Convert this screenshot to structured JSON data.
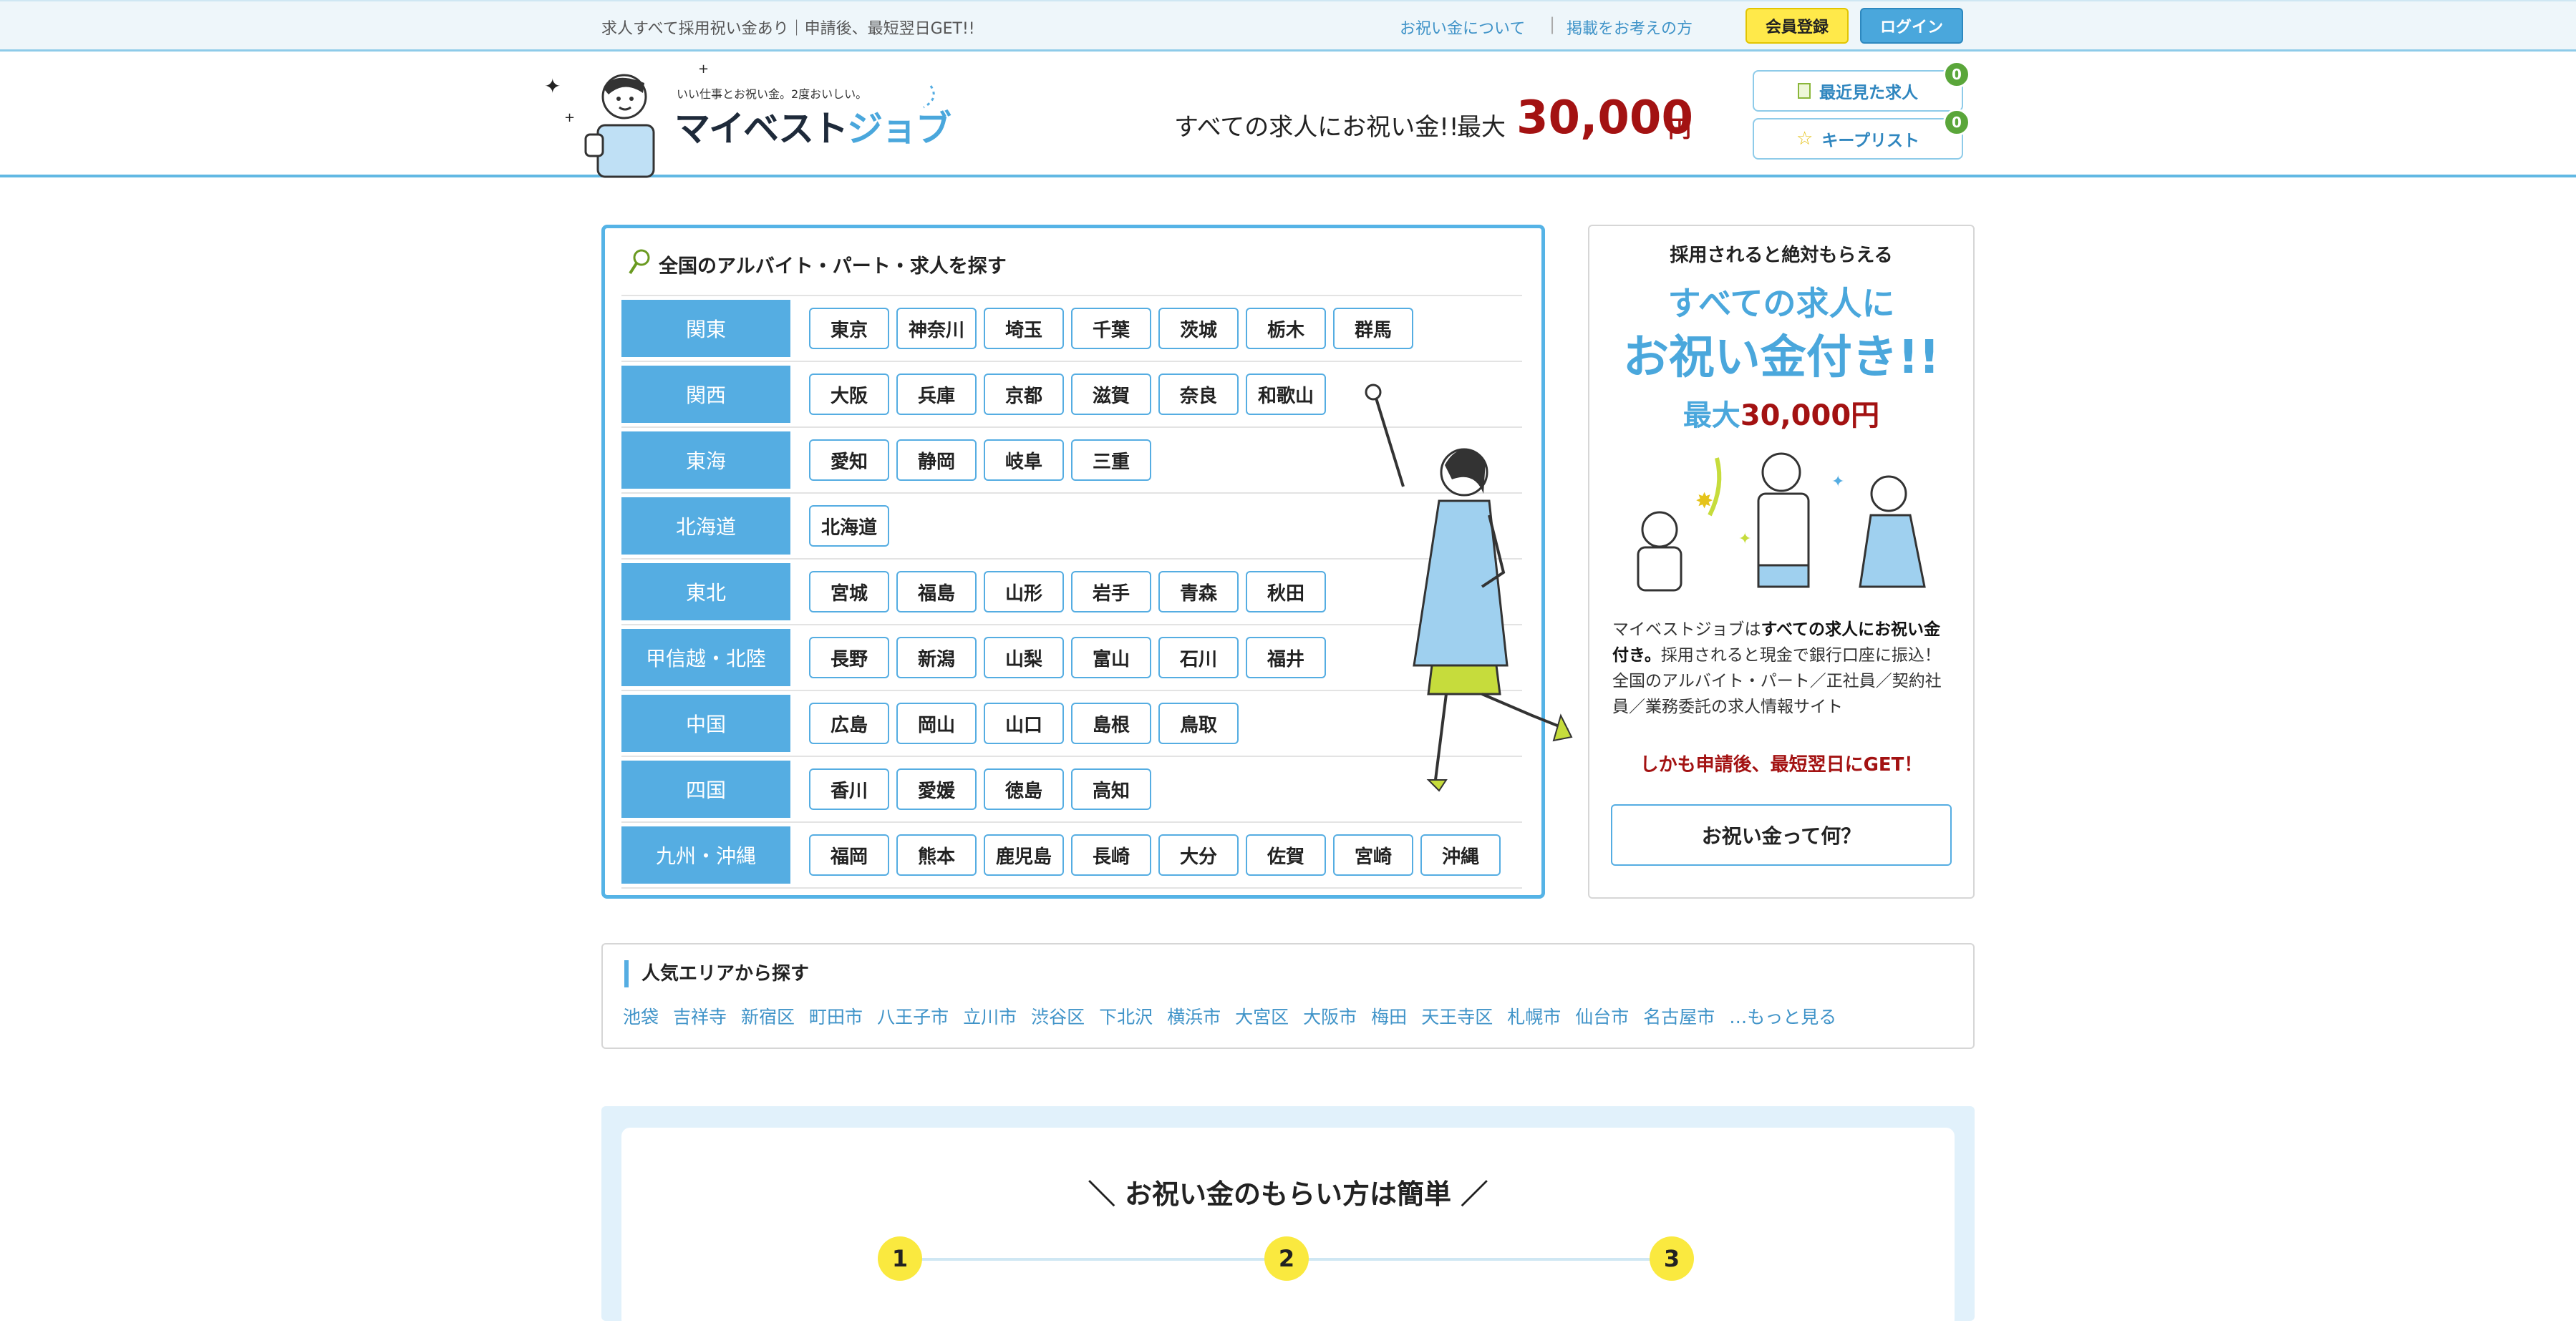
{
  "topbar": {
    "tagline": "求人すべて採用祝い金あり｜申請後、最短翌日GET!!",
    "about_link": "お祝い金について",
    "separator": "|",
    "post_link": "掲載をお考えの方",
    "register_label": "会員登録",
    "login_label": "ログイン"
  },
  "header": {
    "logo_sub": "いい仕事とお祝い金。2度おいしい。",
    "logo_main_a": "マイベスト",
    "logo_main_b": "ジョブ",
    "headline": "すべての求人にお祝い金!!",
    "headline_max": "最大",
    "headline_amount": "30,000",
    "headline_unit": "円",
    "recent_label": "最近見た求人",
    "recent_count": "0",
    "keep_label": "キープリスト",
    "keep_count": "0"
  },
  "region_search": {
    "title": "全国のアルバイト・パート・求人を探す",
    "regions": [
      {
        "name": "関東",
        "prefs": [
          "東京",
          "神奈川",
          "埼玉",
          "千葉",
          "茨城",
          "栃木",
          "群馬"
        ]
      },
      {
        "name": "関西",
        "prefs": [
          "大阪",
          "兵庫",
          "京都",
          "滋賀",
          "奈良",
          "和歌山"
        ]
      },
      {
        "name": "東海",
        "prefs": [
          "愛知",
          "静岡",
          "岐阜",
          "三重"
        ]
      },
      {
        "name": "北海道",
        "prefs": [
          "北海道"
        ]
      },
      {
        "name": "東北",
        "prefs": [
          "宮城",
          "福島",
          "山形",
          "岩手",
          "青森",
          "秋田"
        ]
      },
      {
        "name": "甲信越・北陸",
        "prefs": [
          "長野",
          "新潟",
          "山梨",
          "富山",
          "石川",
          "福井"
        ]
      },
      {
        "name": "中国",
        "prefs": [
          "広島",
          "岡山",
          "山口",
          "島根",
          "鳥取"
        ]
      },
      {
        "name": "四国",
        "prefs": [
          "香川",
          "愛媛",
          "徳島",
          "高知"
        ]
      },
      {
        "name": "九州・沖縄",
        "prefs": [
          "福岡",
          "熊本",
          "鹿児島",
          "長崎",
          "大分",
          "佐賀",
          "宮崎",
          "沖縄"
        ]
      }
    ]
  },
  "promo": {
    "lead": "採用されると絶対もらえる",
    "headline_1": "すべての求人に",
    "headline_2": "お祝い金付き!!",
    "max_label": "最大",
    "max_value": "30,000円",
    "desc_brand": "マイベストジョブは",
    "desc_bold": "すべての求人にお祝い金付き。",
    "desc_rest": "採用されると現金で銀行口座に振込！全国のアルバイト・パート／正社員／契約社員／業務委託の求人情報サイト",
    "cta": "しかも申請後、最短翌日にGET！",
    "button_label": "お祝い金って何？"
  },
  "popular": {
    "title": "人気エリアから探す",
    "links": [
      "池袋",
      "吉祥寺",
      "新宿区",
      "町田市",
      "八王子市",
      "立川市",
      "渋谷区",
      "下北沢",
      "横浜市",
      "大宮区",
      "大阪市",
      "梅田",
      "天王寺区",
      "札幌市",
      "仙台市",
      "名古屋市",
      "…もっと見る"
    ]
  },
  "howto": {
    "title": "＼ お祝い金のもらい方は簡単 ／",
    "steps": [
      "1",
      "2",
      "3"
    ]
  },
  "colors": {
    "accent": "#55ade2",
    "amount_red": "#a31212",
    "register_yellow": "#ffe94a",
    "badge_green": "#5aa63a"
  }
}
